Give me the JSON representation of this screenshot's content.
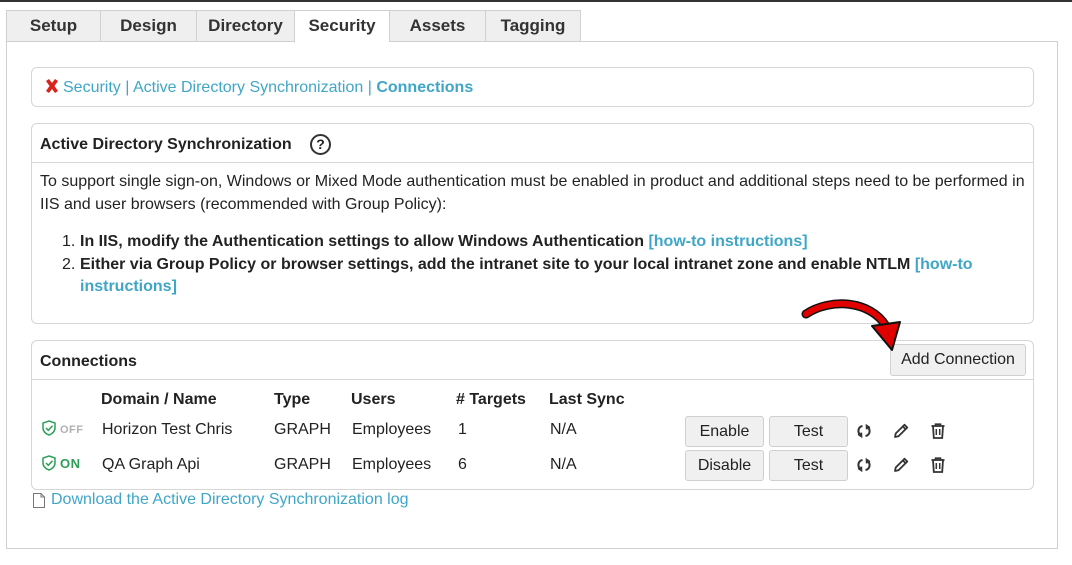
{
  "tabs": [
    {
      "label": "Setup"
    },
    {
      "label": "Design"
    },
    {
      "label": "Directory"
    },
    {
      "label": "Security"
    },
    {
      "label": "Assets"
    },
    {
      "label": "Tagging"
    }
  ],
  "active_tab": "Security",
  "breadcrumb": {
    "part1": "Security",
    "sep": " | ",
    "part2": "Active Directory Synchronization",
    "current": "Connections"
  },
  "ad_sync": {
    "title": "Active Directory Synchronization",
    "help": "?",
    "description": "To support single sign-on, Windows or Mixed Mode authentication must be enabled in product and additional steps need to be performed in IIS and user browsers (recommended with Group Policy):",
    "steps": [
      {
        "num": "1.",
        "text": "In IIS, modify the Authentication settings to allow Windows Authentication ",
        "link": "[how-to instructions]"
      },
      {
        "num": "2.",
        "text": "Either via Group Policy or browser settings, add the intranet site to your local intranet zone and enable NTLM ",
        "link": "[how-to instructions]"
      }
    ]
  },
  "connections": {
    "title": "Connections",
    "add_button": "Add Connection",
    "columns": [
      "Domain / Name",
      "Type",
      "Users",
      "# Targets",
      "Last Sync"
    ],
    "rows": [
      {
        "status": "OFF",
        "name": "Horizon Test Chris",
        "type": "GRAPH",
        "users": "Employees",
        "targets": "1",
        "last_sync": "N/A",
        "toggle_label": "Enable",
        "test_label": "Test"
      },
      {
        "status": "ON",
        "name": "QA Graph Api",
        "type": "GRAPH",
        "users": "Employees",
        "targets": "6",
        "last_sync": "N/A",
        "toggle_label": "Disable",
        "test_label": "Test"
      }
    ]
  },
  "log_link": "Download the Active Directory Synchronization log",
  "colors": {
    "link": "#3fa6c7",
    "status_on": "#2e9e57",
    "status_off": "#b0b0b0",
    "arrow": "#e00000",
    "close_icon": "#d9241c"
  },
  "icons": {
    "breadcrumb": "close-icon",
    "help": "help-circle-icon",
    "status": "shield-check-icon",
    "sync": "sync-icon",
    "edit": "pencil-icon",
    "delete": "trash-icon",
    "log": "document-icon",
    "annotation": "red-arrow-icon"
  }
}
